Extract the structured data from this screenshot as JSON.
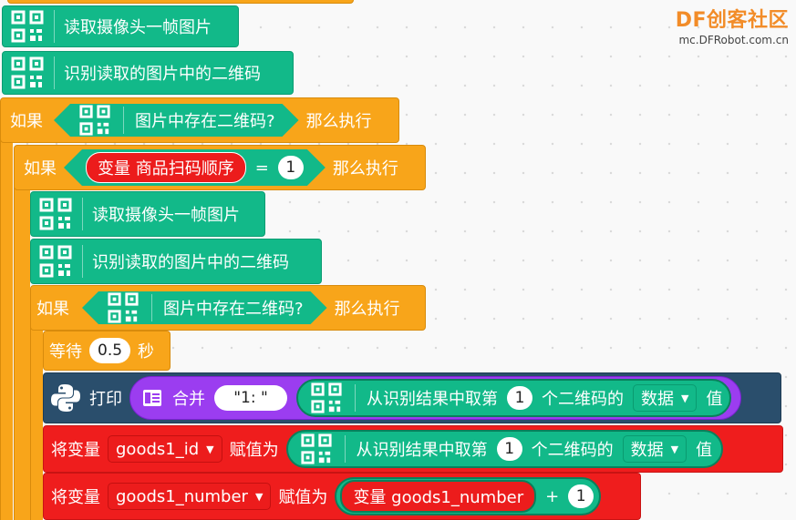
{
  "watermark": {
    "brand": "DF创客社区",
    "url": "mc.DFRobot.com.cn"
  },
  "blocks": {
    "read_frame_1": "读取摄像头一帧图片",
    "identify_1": "识别读取的图片中的二维码",
    "if1": {
      "kw": "如果",
      "cond": "图片中存在二维码?",
      "then": "那么执行"
    },
    "if2": {
      "kw": "如果",
      "var": "变量 商品扫码顺序",
      "op": "=",
      "value": "1",
      "then": "那么执行"
    },
    "read_frame_2": "读取摄像头一帧图片",
    "identify_2": "识别读取的图片中的二维码",
    "if3": {
      "kw": "如果",
      "cond": "图片中存在二维码?",
      "then": "那么执行"
    },
    "wait": {
      "label": "等待",
      "value": "0.5",
      "unit": "秒"
    },
    "print": {
      "label": "打印",
      "merge": "合并",
      "str": "\"1: \"",
      "from": "从识别结果中取第",
      "index": "1",
      "nth": "个二维码的",
      "field": "数据",
      "val": "值"
    },
    "set1": {
      "label": "将变量",
      "var": "goods1_id",
      "assign": "赋值为",
      "from": "从识别结果中取第",
      "index": "1",
      "nth": "个二维码的",
      "field": "数据",
      "val": "值"
    },
    "set2": {
      "label": "将变量",
      "var": "goods1_number",
      "assign": "赋值为",
      "operand": "变量 goods1_number",
      "op": "+",
      "value": "1"
    }
  }
}
